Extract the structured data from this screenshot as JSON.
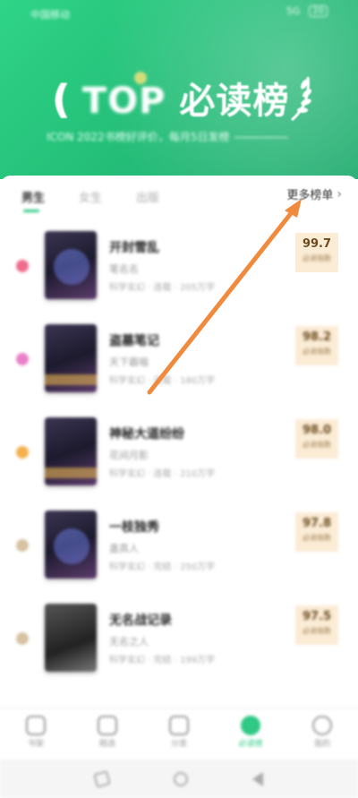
{
  "status_bar": {
    "left": "中国移动",
    "network": "5G",
    "battery": "20"
  },
  "header": {
    "title_prefix": "TOP",
    "title_main": "必读榜",
    "subtitle": "ICON 2022书榜好评价，每月5日发榜"
  },
  "tabs": [
    {
      "label": "男生",
      "active": true
    },
    {
      "label": "女生",
      "active": false
    },
    {
      "label": "出版",
      "active": false
    }
  ],
  "more_label": "更多榜单",
  "books": [
    {
      "title": "开封雪乱",
      "author": "笔名名",
      "meta": "科学玄幻 · 连载 · 205万字",
      "score": "99.7",
      "score_label": "必读指数",
      "dot_color": "#f06b8b"
    },
    {
      "title": "盗墓笔记",
      "author": "天下霸唱",
      "meta": "科学玄幻 · 连载 · 180万字",
      "score": "98.2",
      "score_label": "必读指数",
      "dot_color": "#e97fc9"
    },
    {
      "title": "神秘大道纷纷",
      "author": "花间月影",
      "meta": "科学玄幻 · 连载 · 210万字",
      "score": "98.0",
      "score_label": "必读指数",
      "dot_color": "#f3b14d"
    },
    {
      "title": "一枝独秀",
      "author": "蛊真人",
      "meta": "科学玄幻 · 完结 · 250万字",
      "score": "97.8",
      "score_label": "必读指数",
      "dot_color": "#d6c3a1"
    },
    {
      "title": "无名战记录",
      "author": "无名之人",
      "meta": "科学玄幻 · 完结 · 199万字",
      "score": "97.5",
      "score_label": "必读指数",
      "dot_color": "#d6c3a1"
    }
  ],
  "bottom_nav": [
    {
      "label": "书架",
      "active": false
    },
    {
      "label": "精选",
      "active": false
    },
    {
      "label": "分类",
      "active": false
    },
    {
      "label": "必读榜",
      "active": true
    },
    {
      "label": "我的",
      "active": false
    }
  ],
  "colors": {
    "accent": "#2fc985",
    "arrow": "#f08a3c",
    "score_bg": "#fbecd6"
  }
}
